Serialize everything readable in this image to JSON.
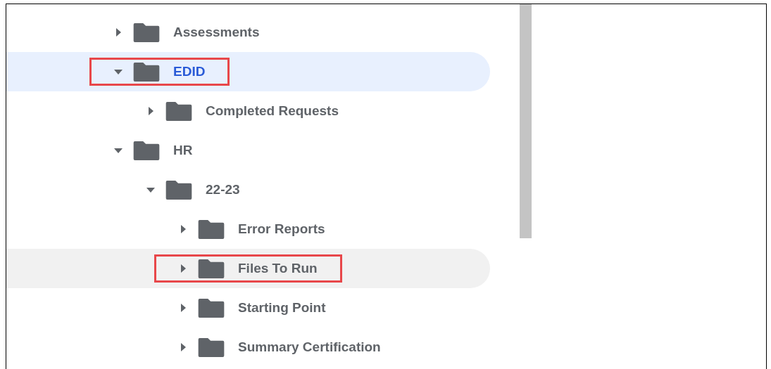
{
  "folder_tree": [
    {
      "label": "Assessments",
      "expanded": false,
      "selected": false,
      "hovered": false,
      "annotated": false
    },
    {
      "label": "EDID",
      "expanded": true,
      "selected": true,
      "hovered": false,
      "annotated": true,
      "children": [
        {
          "label": "Completed Requests",
          "expanded": false,
          "selected": false,
          "hovered": false,
          "annotated": false
        }
      ]
    },
    {
      "label": "HR",
      "expanded": true,
      "selected": false,
      "hovered": false,
      "annotated": false,
      "children": [
        {
          "label": "22-23",
          "expanded": true,
          "selected": false,
          "hovered": false,
          "annotated": false,
          "children": [
            {
              "label": "Error Reports",
              "expanded": false,
              "selected": false,
              "hovered": false,
              "annotated": false
            },
            {
              "label": "Files To Run",
              "expanded": false,
              "selected": false,
              "hovered": true,
              "annotated": true
            },
            {
              "label": "Starting Point",
              "expanded": false,
              "selected": false,
              "hovered": false,
              "annotated": false
            },
            {
              "label": "Summary Certification",
              "expanded": false,
              "selected": false,
              "hovered": false,
              "annotated": false
            }
          ]
        }
      ]
    }
  ]
}
